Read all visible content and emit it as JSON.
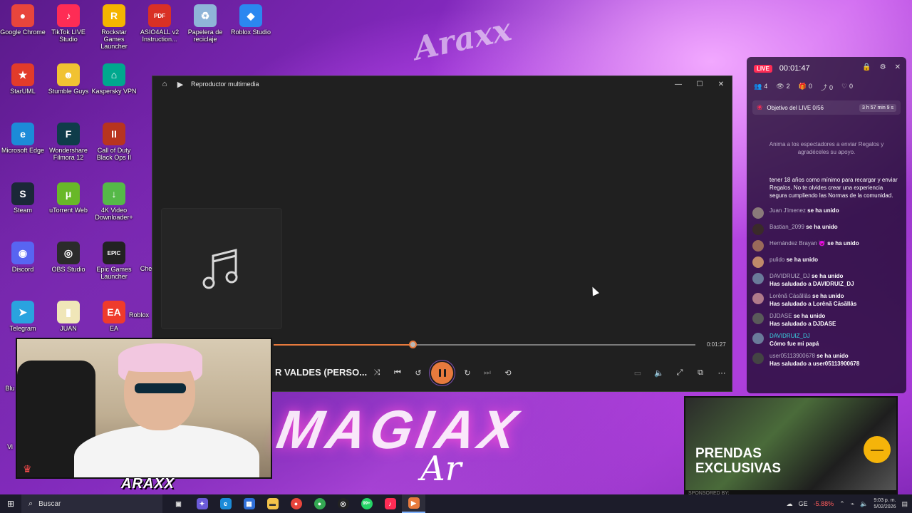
{
  "desktop": {
    "icons": [
      {
        "label": "Google Chrome",
        "color": "#e8453c",
        "glyph": "●"
      },
      {
        "label": "TikTok LIVE Studio",
        "color": "#fe2c55",
        "glyph": "♪"
      },
      {
        "label": "Rockstar Games Launcher",
        "color": "#f5b400",
        "glyph": "R"
      },
      {
        "label": "ASIO4ALL v2 Instruction...",
        "color": "#d93025",
        "glyph": "PDF"
      },
      {
        "label": "Papelera de reciclaje",
        "color": "#8fb4d8",
        "glyph": "♻"
      },
      {
        "label": "Roblox Studio",
        "color": "#2b87f0",
        "glyph": "◆"
      },
      {
        "label": "StarUML",
        "color": "#e23b2a",
        "glyph": "★"
      },
      {
        "label": "Stumble Guys",
        "color": "#f1c232",
        "glyph": "☻"
      },
      {
        "label": "Kaspersky VPN",
        "color": "#00a88e",
        "glyph": "⌂"
      },
      {
        "label": "Microsoft Edge",
        "color": "#1c8bd8",
        "glyph": "e"
      },
      {
        "label": "Wondershare Filmora 12",
        "color": "#0f3c4a",
        "glyph": "F"
      },
      {
        "label": "Call of Duty Black Ops II",
        "color": "#b8341f",
        "glyph": "II"
      },
      {
        "label": "Steam",
        "color": "#1b2838",
        "glyph": "S"
      },
      {
        "label": "uTorrent Web",
        "color": "#68b828",
        "glyph": "μ"
      },
      {
        "label": "4K Video Downloader+",
        "color": "#55b948",
        "glyph": "↓"
      },
      {
        "label": "Discord",
        "color": "#5865f2",
        "glyph": "◉"
      },
      {
        "label": "OBS Studio",
        "color": "#2b2b2b",
        "glyph": "◎"
      },
      {
        "label": "Epic Games Launcher",
        "color": "#222222",
        "glyph": "EPIC"
      },
      {
        "label": "Telegram",
        "color": "#2aa3df",
        "glyph": "➤"
      },
      {
        "label": "JUAN",
        "color": "#f0e6b8",
        "glyph": "▮"
      },
      {
        "label": "EA",
        "color": "#ef3b2c",
        "glyph": "EA"
      }
    ],
    "partial_labels": [
      "Roblox",
      "Che",
      "Blu",
      "Vi"
    ]
  },
  "wallpaper": {
    "top_mark": "Araxx"
  },
  "player": {
    "title": "Reproductor multimedia",
    "track_title": "R VALDES (PERSO...",
    "duration": "0:01:27",
    "progress": 0.33,
    "accent": "#e77a3d",
    "icons": [
      "home-icon",
      "media-player-icon",
      "music-note-icon",
      "shuffle-icon",
      "previous-icon",
      "rewind-10-icon",
      "pause-icon",
      "forward-30-icon",
      "next-icon",
      "repeat-icon",
      "subtitles-icon",
      "volume-icon",
      "fullscreen-icon",
      "miniplayer-icon",
      "more-icon"
    ]
  },
  "live": {
    "badge": "LIVE",
    "timer": "00:01:47",
    "stats": {
      "viewers": "4",
      "views": "2",
      "gifts": "0",
      "shares": "0",
      "likes": "0"
    },
    "goal": {
      "label": "Objetivo del LIVE 0/56",
      "time_left": "3 h 57 min 9 s"
    },
    "hint": "Anima a los espectadores a enviar Regalos y agradéceles su apoyo.",
    "rules": "tener 18 años como mínimo para recargar y enviar Regalos. No te olvides crear una experiencia segura cumpliendo las Normas de la comunidad.",
    "messages": [
      {
        "user": "Juan J'imenez",
        "text": "se ha unido",
        "sub": "",
        "highlight": false,
        "avatar": "#8a7a7a"
      },
      {
        "user": "Bastian_2099",
        "text": "se ha unido",
        "sub": "",
        "highlight": false,
        "avatar": "#3a2a2a"
      },
      {
        "user": "Hernández Brayan 😈",
        "text": "se ha unido",
        "sub": "",
        "highlight": false,
        "avatar": "#9a6a5a"
      },
      {
        "user": "pulido",
        "text": "se ha unido",
        "sub": "",
        "highlight": false,
        "avatar": "#c08a6a"
      },
      {
        "user": "DAVIDRUIZ_DJ",
        "text": "se ha unido",
        "sub": "Has saludado a DAVIDRUIZ_DJ",
        "highlight": false,
        "avatar": "#6a7a9a"
      },
      {
        "user": "Lorênã Cäsãllâs",
        "text": "se ha unido",
        "sub": "Has saludado a Lorênã Cäsãllâs",
        "highlight": false,
        "avatar": "#b07a8a"
      },
      {
        "user": "DJDASE",
        "text": "se ha unido",
        "sub": "Has saludado a DJDASE",
        "highlight": false,
        "avatar": "#5a5a5a"
      },
      {
        "user": "DAVIDRUIZ_DJ",
        "text": "",
        "sub": "Cómo fue mi papá",
        "highlight": true,
        "avatar": "#6a7a9a"
      },
      {
        "user": "user05113900678",
        "text": "se ha unido",
        "sub": "Has saludado a user05113900678",
        "highlight": false,
        "avatar": "#444444"
      }
    ]
  },
  "webcam": {
    "logo": "ARAXX"
  },
  "banner": {
    "title": "MAGIAX",
    "signature": "Ar"
  },
  "ad": {
    "title_line1": "PRENDAS",
    "title_line2": "EXCLUSIVAS",
    "sponsor": "SPONSORED BY:"
  },
  "taskbar": {
    "search_placeholder": "Buscar",
    "badge": "99+",
    "tray": {
      "ticker": "GE",
      "change": "-5.88%",
      "time": "9:03 p. m.",
      "date": "5/02/2026"
    }
  }
}
